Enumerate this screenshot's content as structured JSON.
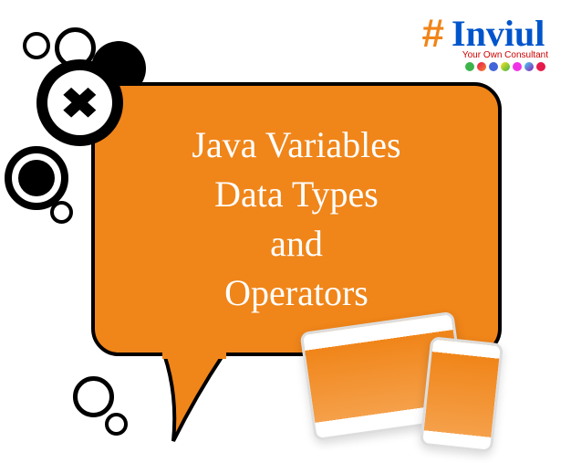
{
  "bubble": {
    "line1": "Java Variables",
    "line2": "Data Types",
    "line3": "and",
    "line4": "Operators"
  },
  "logo": {
    "hash": "#",
    "brand": "Inviul",
    "tagline": "Your Own Consultant"
  },
  "close": {
    "symbol": "✖"
  }
}
